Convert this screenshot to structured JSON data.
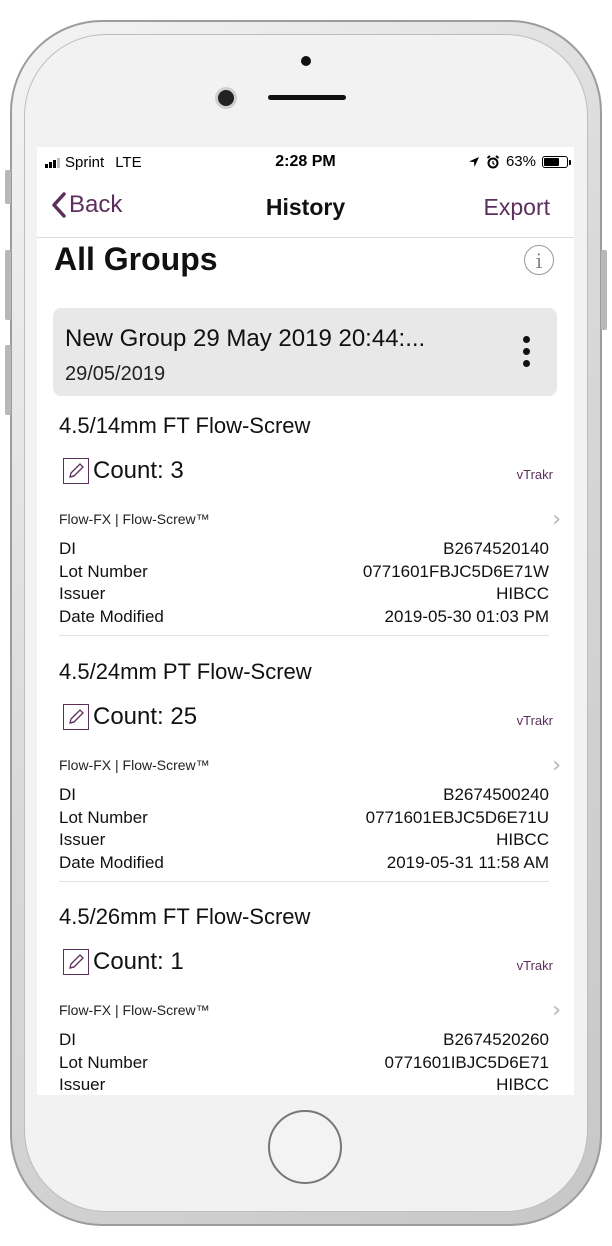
{
  "status_bar": {
    "carrier": "Sprint",
    "network": "LTE",
    "time": "2:28 PM",
    "battery": "63%",
    "icons": [
      "signal-bars-icon",
      "location-arrow-icon",
      "alarm-clock-icon",
      "battery-icon"
    ]
  },
  "nav": {
    "back_label": "Back",
    "title": "History",
    "export_label": "Export",
    "accent_color": "#5d2f5c"
  },
  "page": {
    "title": "All Groups",
    "info_icon": "info-icon"
  },
  "group": {
    "name": "New Group 29 May 2019 20:44:...",
    "date": "29/05/2019",
    "menu_icon": "more-vertical-icon"
  },
  "items": [
    {
      "name": "4.5/14mm FT Flow-Screw",
      "count": "Count: 3",
      "source": "vTrakr",
      "brand": "Flow-FX | Flow-Screw™",
      "fields": [
        {
          "label": "DI",
          "value": "B2674520140"
        },
        {
          "label": "Lot Number",
          "value": "0771601FBJC5D6E71W"
        },
        {
          "label": "Issuer",
          "value": "HIBCC"
        },
        {
          "label": "Date Modified",
          "value": "2019-05-30 01:03 PM"
        }
      ]
    },
    {
      "name": "4.5/24mm PT Flow-Screw",
      "count": "Count: 25",
      "source": "vTrakr",
      "brand": "Flow-FX | Flow-Screw™",
      "fields": [
        {
          "label": "DI",
          "value": "B2674500240"
        },
        {
          "label": "Lot Number",
          "value": "0771601EBJC5D6E71U"
        },
        {
          "label": "Issuer",
          "value": "HIBCC"
        },
        {
          "label": "Date Modified",
          "value": "2019-05-31 11:58 AM"
        }
      ]
    },
    {
      "name": "4.5/26mm FT Flow-Screw",
      "count": "Count: 1",
      "source": "vTrakr",
      "brand": "Flow-FX | Flow-Screw™",
      "fields": [
        {
          "label": "DI",
          "value": "B2674520260"
        },
        {
          "label": "Lot Number",
          "value": "0771601IBJC5D6E71"
        },
        {
          "label": "Issuer",
          "value": "HIBCC"
        }
      ]
    }
  ]
}
